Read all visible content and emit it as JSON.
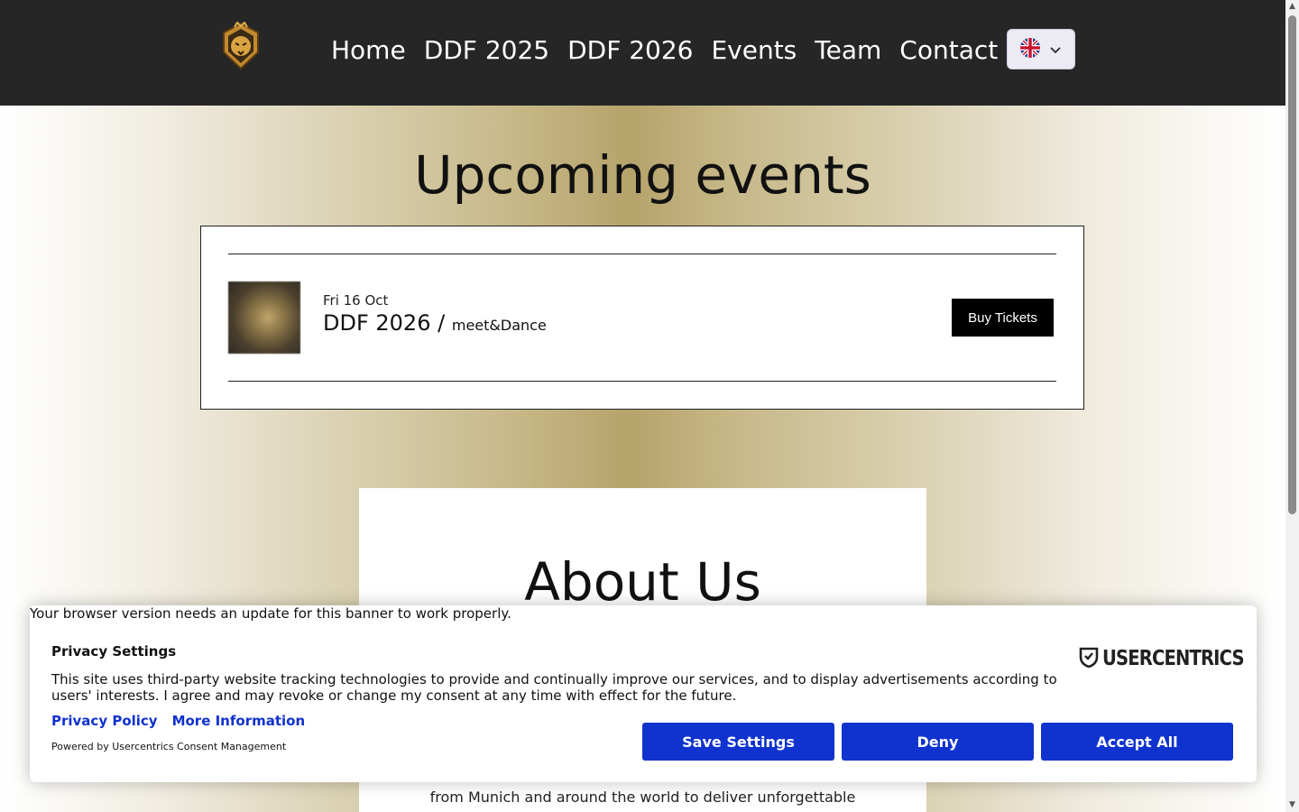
{
  "header": {
    "logo_alt": "lion-logo",
    "nav": [
      "Home",
      "DDF 2025",
      "DDF 2026",
      "Events",
      "Team",
      "Contact"
    ],
    "language_icon": "uk-flag-icon"
  },
  "events": {
    "title": "Upcoming events",
    "items": [
      {
        "date": "Fri 16 Oct",
        "name": "DDF 2026",
        "separator": "/",
        "venue": "meet&Dance",
        "button": "Buy Tickets"
      }
    ]
  },
  "about": {
    "title": "About Us",
    "text_fragment": "from Munich and around the world to deliver unforgettable"
  },
  "consent": {
    "warning": "Your browser version needs an update for this banner to work properly.",
    "heading": "Privacy Settings",
    "body": "This site uses third-party website tracking technologies to provide and continually improve our services, and to display advertisements according to users' interests. I agree and may revoke or change my consent at any time with effect for the future.",
    "links": [
      "Privacy Policy",
      "More Information"
    ],
    "powered_by": "Powered by Usercentrics Consent Management",
    "brand": "USERCENTRICS",
    "buttons": [
      "Save Settings",
      "Deny",
      "Accept All"
    ],
    "button_color": "#1032cf"
  },
  "colors": {
    "header_bg": "#262626",
    "gold_accent": "#b6a36b"
  }
}
